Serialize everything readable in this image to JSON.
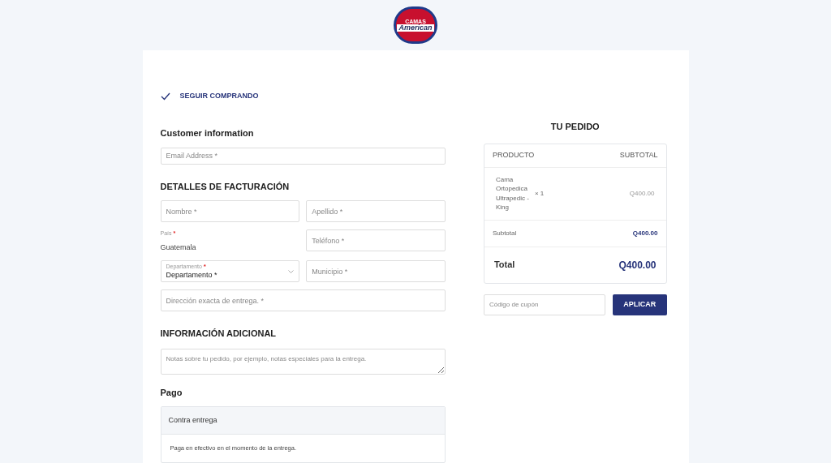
{
  "logo": {
    "line_1": "CAMAS",
    "line_2": "American"
  },
  "continue_link": {
    "label": "SEGUIR COMPRANDO"
  },
  "customer": {
    "title": "Customer information",
    "email": {
      "placeholder": "Email Address *"
    }
  },
  "billing": {
    "title": "DETALLES DE FACTURACIÓN",
    "nombre": {
      "placeholder": "Nombre *"
    },
    "apellido": {
      "placeholder": "Apellido *"
    },
    "pais": {
      "label": "País",
      "required": "*",
      "value": "Guatemala"
    },
    "telefono": {
      "placeholder": "Teléfono *"
    },
    "departamento": {
      "label": "Departamento",
      "required": "*",
      "value": "Departamento *"
    },
    "municipio": {
      "placeholder": "Municipio *"
    },
    "direccion": {
      "placeholder": "Dirección exacta de entrega. *"
    }
  },
  "additional": {
    "title": "INFORMACIÓN ADICIONAL",
    "notes": {
      "placeholder": "Notas sobre tu pedido, por ejemplo, notas especiales para la entrega."
    }
  },
  "payment": {
    "title": "Pago",
    "methods": [
      {
        "label": "Contra entrega",
        "description": "Paga en efectivo en el momento de la entrega."
      }
    ]
  },
  "order": {
    "title": "TU PEDIDO",
    "columns": [
      "PRODUCTO",
      "SUBTOTAL"
    ],
    "items": [
      {
        "name": "Cama Ortopedica Ultrapedic - King",
        "quantity": "× 1",
        "subtotal": "Q400.00"
      }
    ],
    "subtotal": {
      "label": "Subtotal",
      "value": "Q400.00"
    },
    "total": {
      "label": "Total",
      "value": "Q400.00"
    },
    "coupon": {
      "placeholder": "Código de cupón",
      "button": "APLICAR"
    }
  }
}
